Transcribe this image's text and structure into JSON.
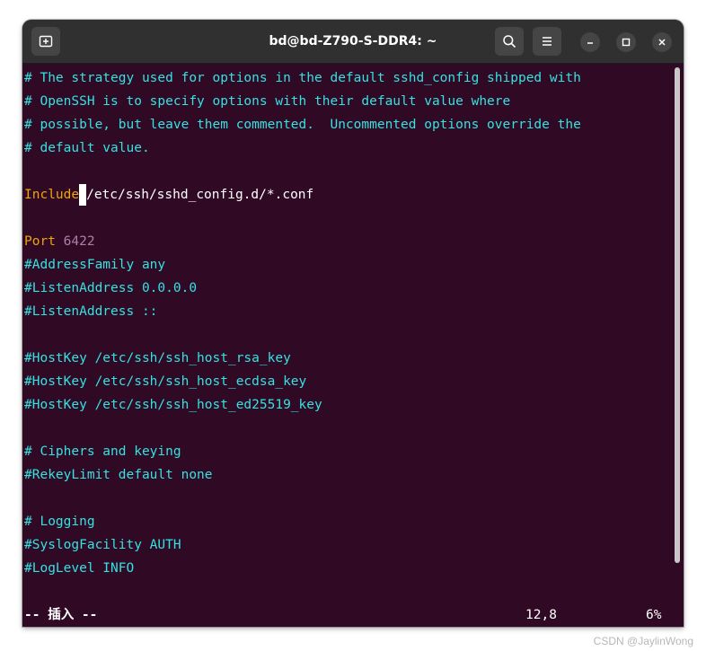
{
  "window": {
    "title": "bd@bd-Z790-S-DDR4: ~",
    "icons": {
      "new_tab": "new-tab-icon",
      "search": "search-icon",
      "menu": "hamburger-menu-icon",
      "minimize": "minimize-icon",
      "maximize": "maximize-icon",
      "close": "close-icon"
    }
  },
  "colors": {
    "terminal_bg": "#300a24",
    "comment": "#34e2e2",
    "keyword": "#f0a30a",
    "number": "#ad7fa8",
    "text": "#ffffff"
  },
  "editor": {
    "lines": [
      "# The strategy used for options in the default sshd_config shipped with",
      "# OpenSSH is to specify options with their default value where",
      "# possible, but leave them commented.  Uncommented options override the",
      "# default value.",
      "",
      "",
      "",
      "",
      "#AddressFamily any",
      "#ListenAddress 0.0.0.0",
      "#ListenAddress ::",
      "",
      "#HostKey /etc/ssh/ssh_host_rsa_key",
      "#HostKey /etc/ssh/ssh_host_ecdsa_key",
      "#HostKey /etc/ssh/ssh_host_ed25519_key",
      "",
      "# Ciphers and keying",
      "#RekeyLimit default none",
      "",
      "# Logging",
      "#SyslogFacility AUTH",
      "#LogLevel INFO"
    ],
    "include_keyword": "Include",
    "include_path": "/etc/ssh/sshd_config.d/*.conf",
    "port_keyword": "Port",
    "port_value": "6422"
  },
  "status": {
    "mode": "-- 插入 --",
    "position": "12,8",
    "percent": "6%"
  },
  "watermark": "CSDN @JaylinWong"
}
